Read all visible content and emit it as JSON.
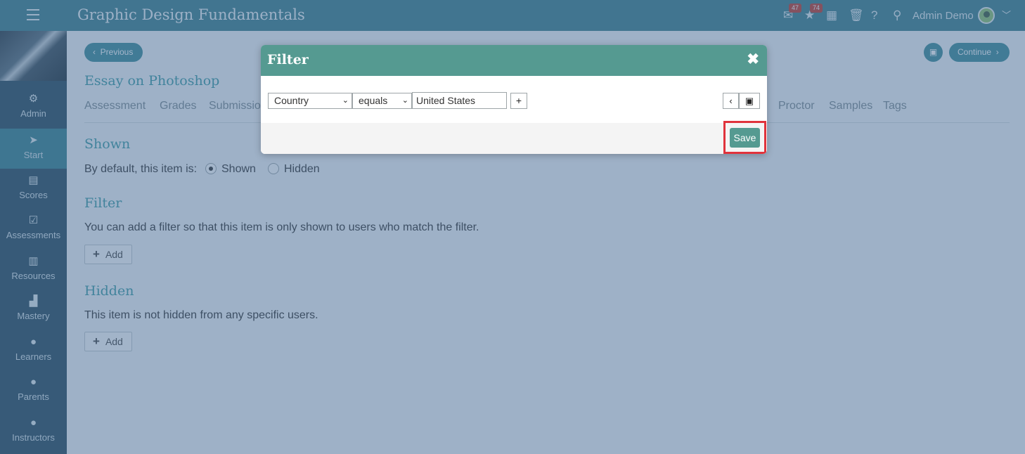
{
  "header": {
    "title": "Graphic Design Fundamentals",
    "messages_badge": "47",
    "notifications_badge": "74",
    "user_name": "Admin Demo"
  },
  "sidebar": {
    "items": [
      {
        "label": "Admin",
        "icon": "gear-icon"
      },
      {
        "label": "Start",
        "icon": "paper-plane-icon"
      },
      {
        "label": "Scores",
        "icon": "table-icon"
      },
      {
        "label": "Assessments",
        "icon": "checkbox-icon"
      },
      {
        "label": "Resources",
        "icon": "books-icon"
      },
      {
        "label": "Mastery",
        "icon": "bar-chart-icon"
      },
      {
        "label": "Learners",
        "icon": "person-icon"
      },
      {
        "label": "Parents",
        "icon": "person-icon"
      },
      {
        "label": "Instructors",
        "icon": "instructor-icon"
      }
    ],
    "active": "Start"
  },
  "nav": {
    "previous": "Previous",
    "continue": "Continue"
  },
  "item_title": "Essay on Photoshop",
  "tabs": [
    "Assessment",
    "Grades",
    "Submissio",
    "Proctor",
    "Samples",
    "Tags"
  ],
  "shown_section": {
    "heading": "Shown",
    "label": "By default, this item is:",
    "option_shown": "Shown",
    "option_hidden": "Hidden",
    "selected": "Shown"
  },
  "filter_section": {
    "heading": "Filter",
    "text": "You can add a filter so that this item is only shown to users who match the filter.",
    "add_label": "Add"
  },
  "hidden_section": {
    "heading": "Hidden",
    "text": "This item is not hidden from any specific users.",
    "add_label": "Add"
  },
  "modal": {
    "title": "Filter",
    "field_value": "Country",
    "operator_value": "equals",
    "text_value": "United States",
    "plus_label": "+",
    "save_label": "Save"
  },
  "colors": {
    "header_bg": "#3b7f8a",
    "sidebar_bg": "#26495a",
    "accent": "#559a91",
    "highlight": "#e0333c"
  }
}
